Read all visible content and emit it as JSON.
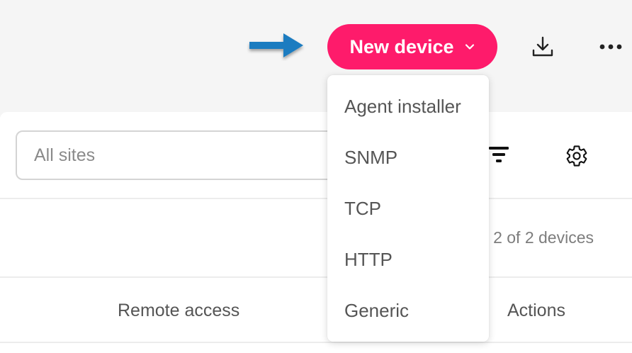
{
  "header": {
    "new_device_label": "New device"
  },
  "dropdown": {
    "items": [
      {
        "label": "Agent installer"
      },
      {
        "label": "SNMP"
      },
      {
        "label": "TCP"
      },
      {
        "label": "HTTP"
      },
      {
        "label": "Generic"
      }
    ]
  },
  "search": {
    "placeholder": "All sites"
  },
  "device_count": "2 of 2 devices",
  "table": {
    "columns": [
      "Remote access",
      "Actions"
    ]
  },
  "colors": {
    "accent": "#fe1b6b",
    "arrow": "#1a7bc0"
  },
  "icons": [
    "arrow-right-icon",
    "chevron-down-icon",
    "download-icon",
    "more-horizontal-icon",
    "filter-icon",
    "gear-icon"
  ]
}
